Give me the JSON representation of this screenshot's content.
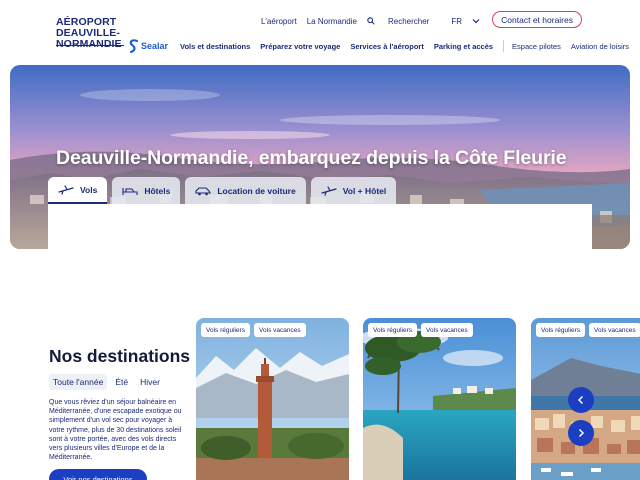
{
  "header": {
    "logo_line1": "AÉROPORT",
    "logo_line2": "DEAUVILLE-NORMANDIE",
    "logo_brand": "Sealar",
    "util_links": [
      "L'aéroport",
      "La Normandie"
    ],
    "search_label": "Rechercher",
    "language": "FR",
    "contact_label": "Contact et horaires",
    "nav": [
      "Vols et destinations",
      "Préparez votre voyage",
      "Services à l'aéroport",
      "Parking et accès"
    ],
    "nav_secondary": [
      "Espace pilotes",
      "Aviation de loisirs"
    ]
  },
  "hero": {
    "title": "Deauville-Normandie, embarquez depuis la Côte Fleurie",
    "tabs": [
      {
        "label": "Vols",
        "icon": "plane-icon",
        "active": true
      },
      {
        "label": "Hôtels",
        "icon": "bed-icon",
        "active": false
      },
      {
        "label": "Location de voiture",
        "icon": "car-icon",
        "active": false
      },
      {
        "label": "Vol + Hôtel",
        "icon": "plane-hotel-icon",
        "active": false
      }
    ]
  },
  "destinations": {
    "title": "Nos destinations",
    "seasons": [
      "Toute l'année",
      "Été",
      "Hiver"
    ],
    "active_season": "Toute l'année",
    "description": "Que vous rêviez d'un séjour balnéaire en Méditerranée, d'une escapade exotique ou simplement d'un vol sec pour voyager à votre rythme, plus de 30 destinations soleil sont à votre portée, avec des vols directs vers plusieurs villes d'Europe et de la Méditerranée.",
    "button_label": "Voir nos destinations",
    "cards": [
      {
        "badges": [
          "Vols réguliers",
          "Vols vacances"
        ],
        "image": "marrakech-minaret"
      },
      {
        "badges": [
          "Vols réguliers",
          "Vols vacances"
        ],
        "image": "mediterranean-cove"
      },
      {
        "badges": [
          "Vols réguliers",
          "Vols vacances"
        ],
        "image": "coastal-town-volcano"
      }
    ]
  },
  "colors": {
    "navy": "#1c2a78",
    "accent_blue": "#1b3ec2",
    "contact_border": "#d9415c"
  }
}
